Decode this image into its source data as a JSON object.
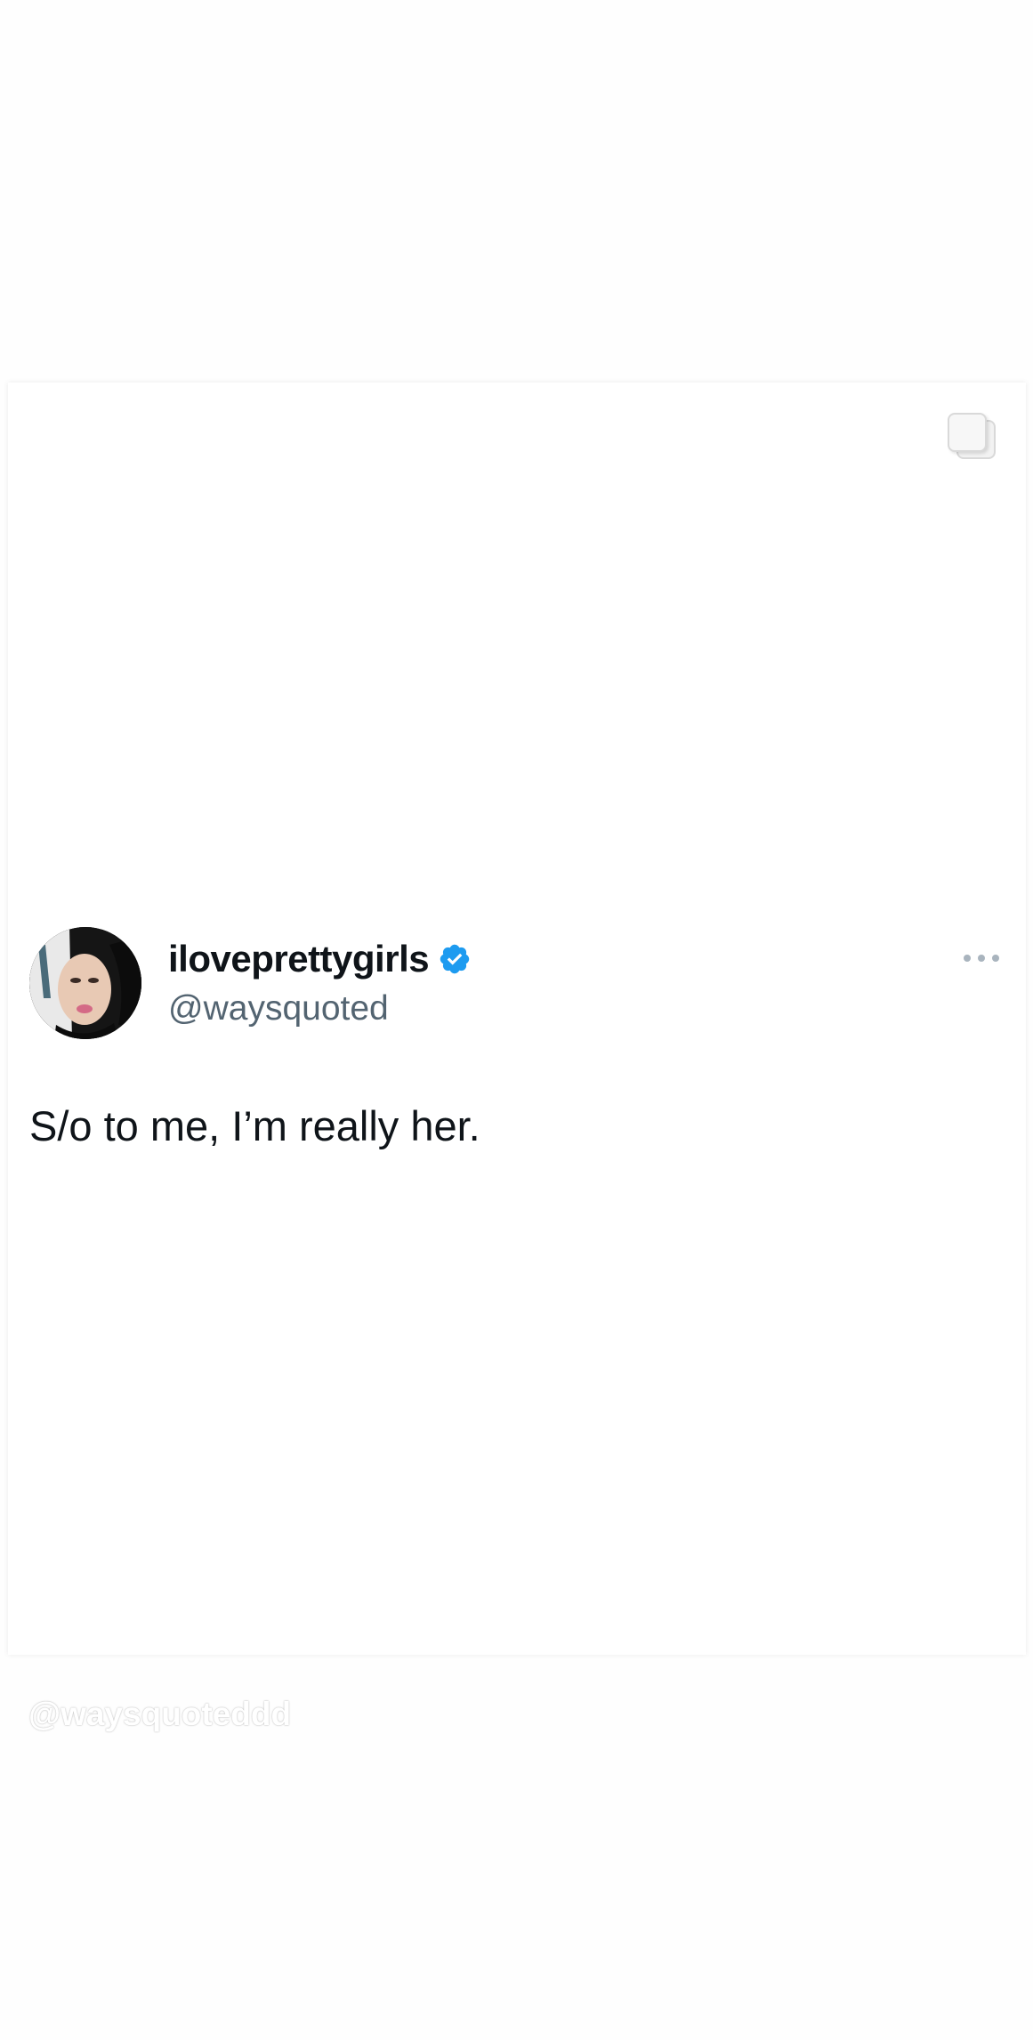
{
  "tweet": {
    "display_name": "iloveprettygirls",
    "handle": "@waysquoted",
    "text": "S/o to me, I’m really her.",
    "verified_color": "#1d9bf0"
  },
  "watermark": {
    "text": "@waysquoteddd"
  },
  "icons": {
    "more": "more-options-icon",
    "verified": "verified-badge-icon",
    "multi_image": "multiple-images-icon"
  }
}
